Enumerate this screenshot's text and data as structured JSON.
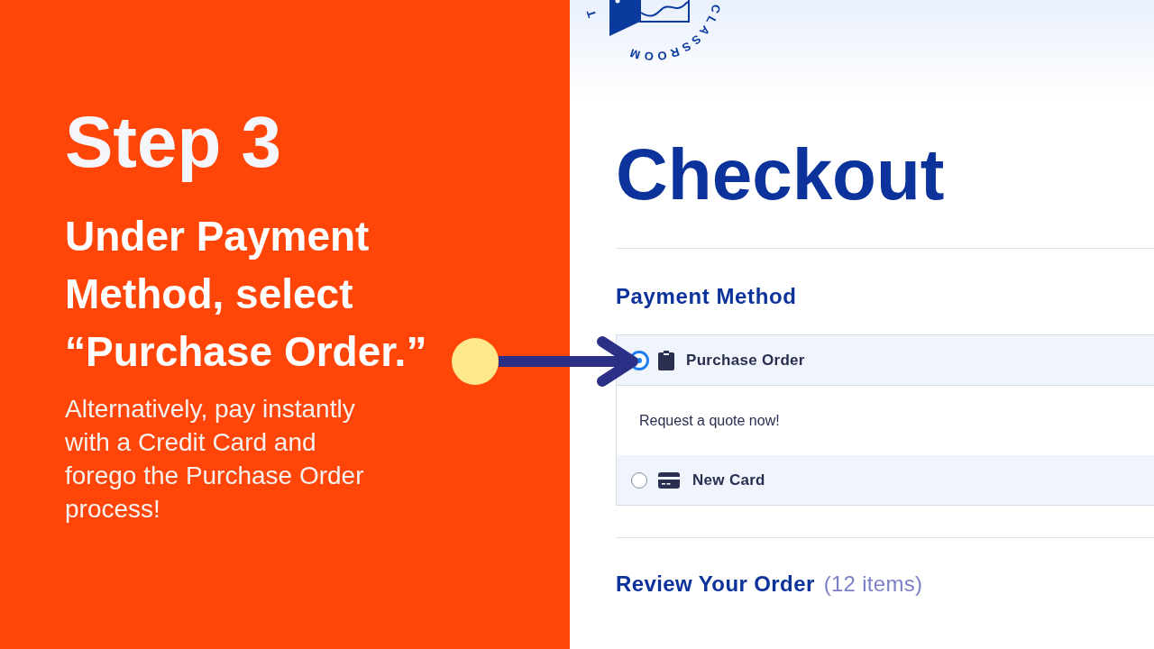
{
  "slide": {
    "step_title": "Step 3",
    "heading": "Under Payment Method, select “Purchase Order.”",
    "body": "Alternatively, pay instantly with a Credit Card and forego the Purchase Order process!"
  },
  "logo": {
    "arc_text": "CLASSROOM",
    "partial_letter": "T"
  },
  "checkout": {
    "title": "Checkout",
    "payment_method": {
      "heading": "Payment Method",
      "options": [
        {
          "kind": "purchase_order",
          "label": "Purchase Order",
          "selected": true,
          "description": "Request a quote now!"
        },
        {
          "kind": "card",
          "label": "New Card",
          "selected": false
        }
      ]
    },
    "review": {
      "heading": "Review Your Order",
      "count": "(12 items)"
    }
  }
}
